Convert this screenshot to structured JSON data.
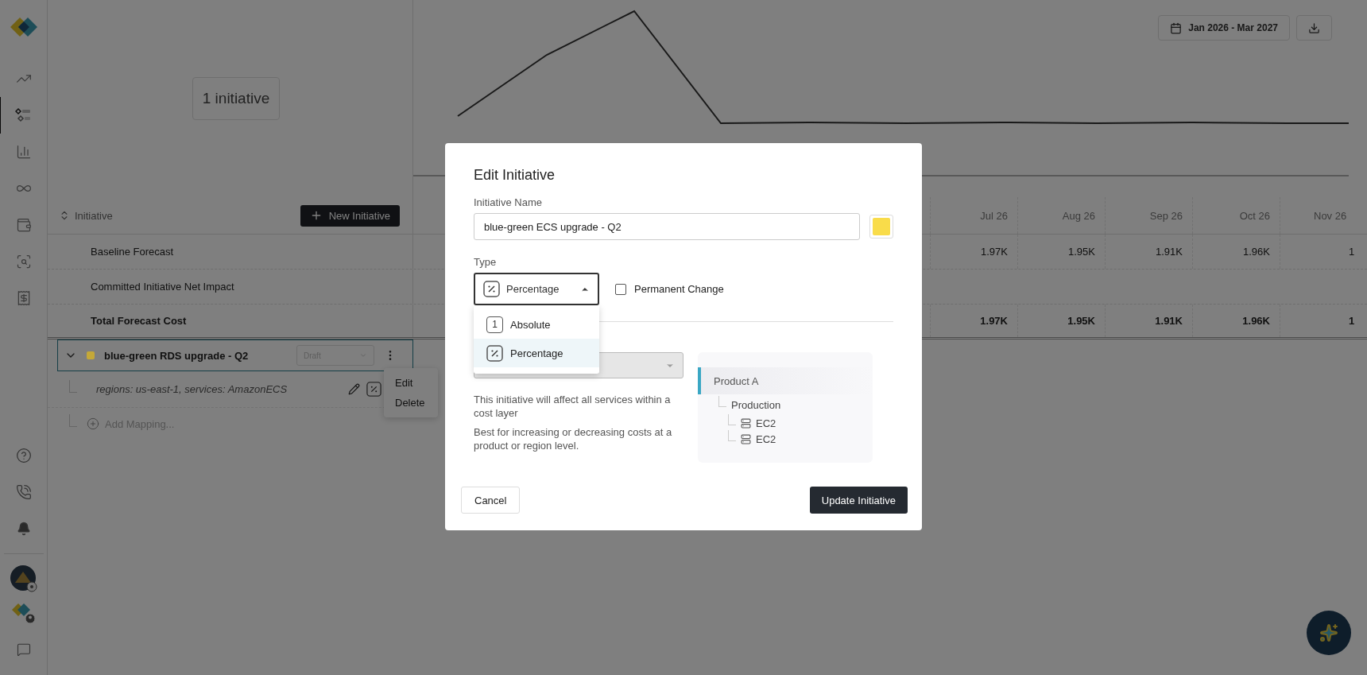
{
  "sidebar": {
    "nav": [
      {
        "selected": false
      },
      {
        "selected": true
      },
      {
        "selected": false
      },
      {
        "selected": false
      },
      {
        "selected": false
      },
      {
        "selected": false
      },
      {
        "selected": false
      }
    ]
  },
  "summary": {
    "count_label": "1 initiative"
  },
  "toolbar": {
    "date_range": "Jan 2026 - Mar 2027"
  },
  "table": {
    "sort_label": "Initiative",
    "new_button": "New Initiative",
    "columns": [
      "Jul 26",
      "Aug 26",
      "Sep 26",
      "Oct 26",
      "Nov 26"
    ],
    "rows": [
      {
        "label": "Baseline Forecast",
        "bold": false,
        "values": [
          "1.97K",
          "1.95K",
          "1.91K",
          "1.96K",
          "1"
        ]
      },
      {
        "label": "Committed Initiative Net Impact",
        "bold": false
      },
      {
        "label": "Total Forecast Cost",
        "bold": true,
        "values": [
          "1.97K",
          "1.95K",
          "1.91K",
          "1.96K",
          "1"
        ]
      }
    ]
  },
  "initiatives": [
    {
      "name": "blue-green RDS upgrade - Q2",
      "color": "#c4a838",
      "status": "Draft",
      "expanded": true,
      "mappings": [
        {
          "text": "regions: us-east-1, services: AmazonECS"
        }
      ],
      "add_mapping": "Add Mapping..."
    }
  ],
  "context_menu": {
    "items": [
      "Edit",
      "Delete"
    ]
  },
  "modal": {
    "title": "Edit Initiative",
    "name_label": "Initiative Name",
    "name_value": "blue-green ECS upgrade - Q2",
    "color": "#f9dc4a",
    "type_label": "Type",
    "type_value": "Percentage",
    "type_expanded": true,
    "type_options": [
      {
        "label": "Absolute",
        "kind": "absolute",
        "glyph": "1",
        "selected": false
      },
      {
        "label": "Percentage",
        "kind": "percentage",
        "selected": true
      }
    ],
    "permanent_change": {
      "label": "Permanent Change",
      "checked": false
    },
    "layer_select": {
      "disabled": true
    },
    "description": [
      "This initiative will affect all services within a cost layer",
      "Best for increasing or decreasing costs at a product or region level."
    ],
    "tree": [
      {
        "label": "Product A",
        "selected": true,
        "children": [
          {
            "label": "Production",
            "children": [
              {
                "label": "EC2",
                "kind": "service"
              },
              {
                "label": "EC2",
                "kind": "service"
              }
            ]
          }
        ]
      }
    ],
    "cancel_button": "Cancel",
    "submit_button": "Update Initiative"
  }
}
